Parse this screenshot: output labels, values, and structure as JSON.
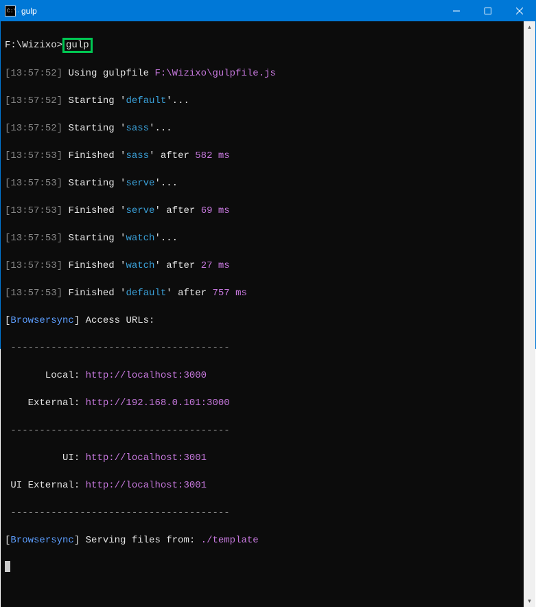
{
  "titlebar": {
    "icon_text": "C:\\.",
    "title": "gulp"
  },
  "prompt": {
    "path": "F:\\Wizixo>",
    "command": "gulp"
  },
  "lines": {
    "l1_ts": "13:57:52",
    "l1_a": "Using gulpfile",
    "l1_b": "F:\\Wizixo\\gulpfile.js",
    "l2_ts": "13:57:52",
    "l2_a": "Starting '",
    "l2_b": "default",
    "l2_c": "'...",
    "l3_ts": "13:57:52",
    "l3_a": "Starting '",
    "l3_b": "sass",
    "l3_c": "'...",
    "l4_ts": "13:57:53",
    "l4_a": "Finished '",
    "l4_b": "sass",
    "l4_c": "' after",
    "l4_d": "582 ms",
    "l5_ts": "13:57:53",
    "l5_a": "Starting '",
    "l5_b": "serve",
    "l5_c": "'...",
    "l6_ts": "13:57:53",
    "l6_a": "Finished '",
    "l6_b": "serve",
    "l6_c": "' after",
    "l6_d": "69 ms",
    "l7_ts": "13:57:53",
    "l7_a": "Starting '",
    "l7_b": "watch",
    "l7_c": "'...",
    "l8_ts": "13:57:53",
    "l8_a": "Finished '",
    "l8_b": "watch",
    "l8_c": "' after",
    "l8_d": "27 ms",
    "l9_ts": "13:57:53",
    "l9_a": "Finished '",
    "l9_b": "default",
    "l9_c": "' after",
    "l9_d": "757 ms",
    "bs_label": "Browsersync",
    "bs_access": " Access URLs:",
    "dashes": " --------------------------------------",
    "local_lbl": "       Local:",
    "local_url": "http://localhost:3000",
    "ext_lbl": "    External:",
    "ext_url": "http://192.168.0.101:3000",
    "ui_lbl": "          UI:",
    "ui_url": "http://localhost:3001",
    "uiext_lbl": " UI External:",
    "uiext_url": "http://localhost:3001",
    "serving_a": " Serving files from:",
    "serving_b": "./template"
  }
}
